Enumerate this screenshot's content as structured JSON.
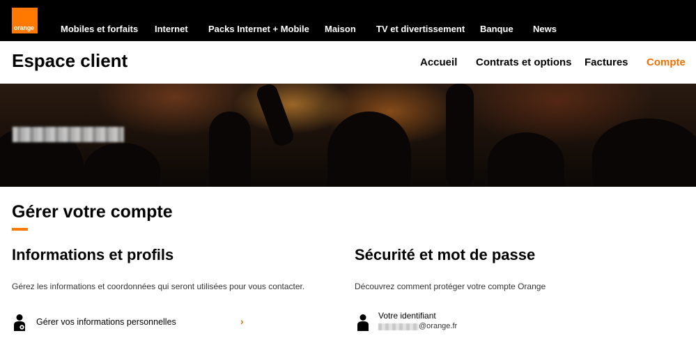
{
  "brand": {
    "logo_text": "orange",
    "color": "#ff7900"
  },
  "top_nav": [
    {
      "label": "Mobiles et forfaits"
    },
    {
      "label": "Internet"
    },
    {
      "label": "Packs Internet + Mobile"
    },
    {
      "label": "Maison"
    },
    {
      "label": "TV et divertissement"
    },
    {
      "label": "Banque"
    },
    {
      "label": "News"
    }
  ],
  "subheader": {
    "title": "Espace client",
    "nav": [
      {
        "label": "Accueil",
        "active": false
      },
      {
        "label": "Contrats et options",
        "active": false
      },
      {
        "label": "Factures",
        "active": false
      },
      {
        "label": "Compte",
        "active": true
      }
    ],
    "active_color": "#f16e00"
  },
  "main": {
    "title": "Gérer votre compte",
    "sections": [
      {
        "title": "Informations et profils",
        "description": "Gérez les informations et coordonnées qui seront utilisées pour vous contacter.",
        "items": [
          {
            "label": "Gérer vos informations personnelles",
            "icon": "person-settings-icon",
            "chevron": "›"
          }
        ]
      },
      {
        "title": "Sécurité et mot de passe",
        "description": "Découvrez comment protéger votre compte Orange",
        "identifier_label": "Votre identifiant",
        "identifier_suffix": "@orange.fr",
        "icon": "person-icon"
      }
    ]
  }
}
